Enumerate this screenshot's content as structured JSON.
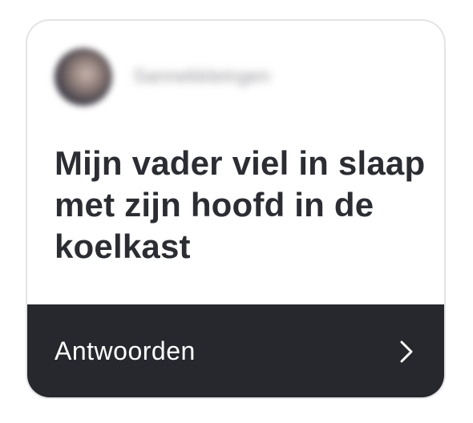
{
  "post": {
    "username": "Sannekkleingen",
    "question": "Mijn vader viel in slaap met zijn hoofd in de koelkast"
  },
  "footer": {
    "reply_label": "Antwoorden",
    "chevron_icon": "chevron-right-icon"
  },
  "colors": {
    "footer_bg": "#26282d",
    "text_dark": "#2b2d33",
    "card_border": "#e4e4e6"
  }
}
